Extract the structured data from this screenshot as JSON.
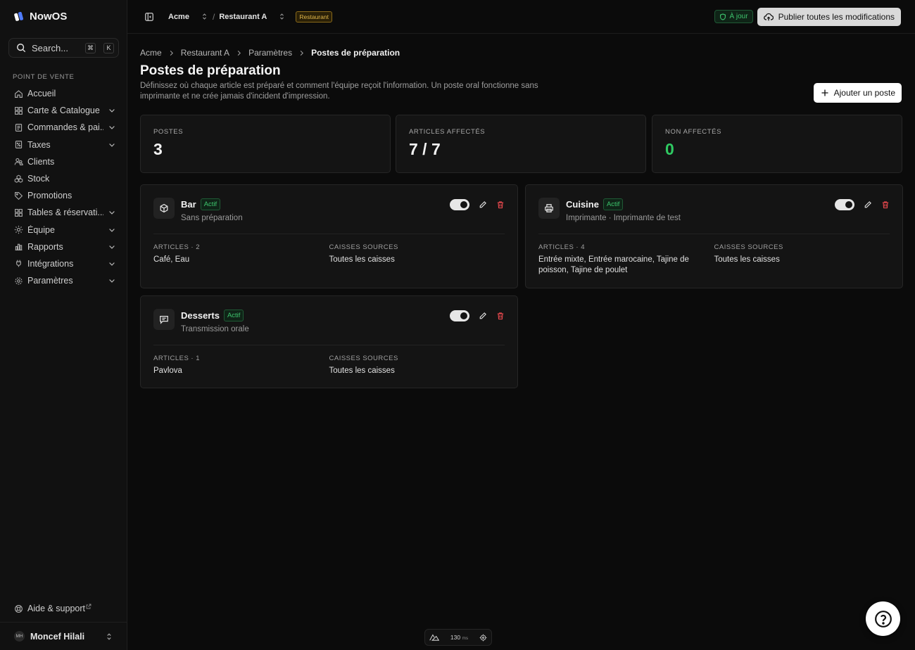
{
  "app": {
    "name": "NowOS"
  },
  "search": {
    "placeholder": "Search...",
    "kbd1": "⌘",
    "kbd2": "K"
  },
  "sidebar": {
    "section": "POINT DE VENTE",
    "items": [
      {
        "label": "Accueil",
        "icon": "home-icon",
        "chevron": false
      },
      {
        "label": "Carte & Catalogue",
        "icon": "grid-icon",
        "chevron": true
      },
      {
        "label": "Commandes & pai...",
        "icon": "receipt-icon",
        "chevron": true
      },
      {
        "label": "Taxes",
        "icon": "percent-icon",
        "chevron": true
      },
      {
        "label": "Clients",
        "icon": "users-icon",
        "chevron": false
      },
      {
        "label": "Stock",
        "icon": "boxes-icon",
        "chevron": false
      },
      {
        "label": "Promotions",
        "icon": "tag-icon",
        "chevron": false
      },
      {
        "label": "Tables & réservati...",
        "icon": "table-icon",
        "chevron": true
      },
      {
        "label": "Équipe",
        "icon": "team-icon",
        "chevron": true
      },
      {
        "label": "Rapports",
        "icon": "chart-icon",
        "chevron": true
      },
      {
        "label": "Intégrations",
        "icon": "plug-icon",
        "chevron": true
      },
      {
        "label": "Paramètres",
        "icon": "gear-icon",
        "chevron": true
      }
    ],
    "help": "Aide & support",
    "user": {
      "initials": "MH",
      "name": "Moncef Hilali"
    }
  },
  "topbar": {
    "org": "Acme",
    "separator": "/",
    "location": "Restaurant A",
    "location_tag": "Restaurant",
    "status": "À jour",
    "publish": "Publier toutes les modifications"
  },
  "breadcrumb": [
    "Acme",
    "Restaurant A",
    "Paramètres",
    "Postes de préparation"
  ],
  "page": {
    "title": "Postes de préparation",
    "description": "Définissez où chaque article est préparé et comment l'équipe reçoit l'information. Un poste oral fonctionne sans imprimante et ne crée jamais d'incident d'impression.",
    "add_button": "Ajouter un poste"
  },
  "stats": [
    {
      "label": "POSTES",
      "value": "3"
    },
    {
      "label": "ARTICLES AFFECTÉS",
      "value": "7 / 7"
    },
    {
      "label": "NON AFFECTÉS",
      "value": "0"
    }
  ],
  "stations": [
    {
      "name": "Bar",
      "badge": "Actif",
      "subtitle": "Sans préparation",
      "articles_label": "ARTICLES · 2",
      "articles": "Café, Eau",
      "sources_label": "CAISSES SOURCES",
      "sources": "Toutes les caisses",
      "enabled": true
    },
    {
      "name": "Cuisine",
      "badge": "Actif",
      "subtitle": "Imprimante · Imprimante de test",
      "articles_label": "ARTICLES · 4",
      "articles": "Entrée mixte, Entrée marocaine, Tajine de poisson, Tajine de poulet",
      "sources_label": "CAISSES SOURCES",
      "sources": "Toutes les caisses",
      "enabled": true
    },
    {
      "name": "Desserts",
      "badge": "Actif",
      "subtitle": "Transmission orale",
      "articles_label": "ARTICLES · 1",
      "articles": "Pavlova",
      "sources_label": "CAISSES SOURCES",
      "sources": "Toutes les caisses",
      "enabled": true
    }
  ],
  "perf": {
    "value": "130",
    "unit": "ms"
  },
  "colors": {
    "accent_green": "#2fca62",
    "danger": "#e5484d",
    "restaurant_tag": "#e0b64a"
  }
}
